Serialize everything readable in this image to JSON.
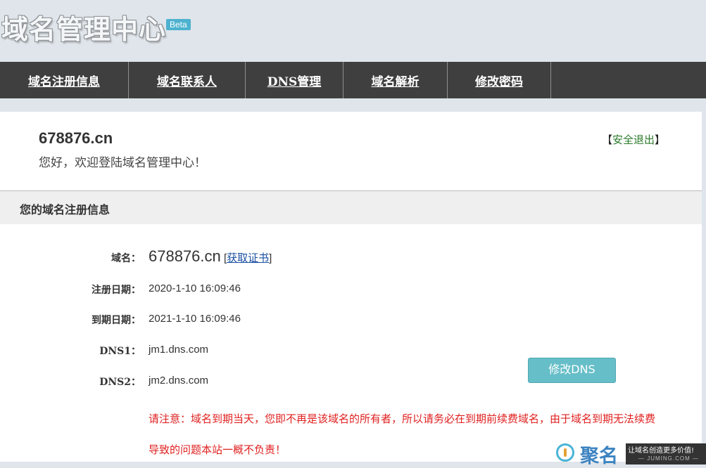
{
  "header": {
    "logo_text": "域名管理中心",
    "beta_label": "Beta"
  },
  "nav": {
    "items": [
      {
        "label": "域名注册信息"
      },
      {
        "label": "域名联系人"
      },
      {
        "label": "DNS管理"
      },
      {
        "label": "域名解析"
      },
      {
        "label": "修改密码"
      }
    ]
  },
  "account": {
    "domain": "678876.cn",
    "welcome": "您好，欢迎登陆域名管理中心！",
    "logout_open": "【",
    "logout_label": "安全退出",
    "logout_close": "】"
  },
  "section": {
    "title": "您的域名注册信息"
  },
  "details": {
    "domain_label": "域名：",
    "domain_value": "678876.cn",
    "cert_open": "[",
    "cert_link": "获取证书",
    "cert_close": "]",
    "reg_label": "注册日期：",
    "reg_value": "2020-1-10 16:09:46",
    "exp_label": "到期日期：",
    "exp_value": "2021-1-10 16:09:46",
    "dns1_label": "DNS1：",
    "dns1_value": "jm1.dns.com",
    "dns2_label": "DNS2：",
    "dns2_value": "jm2.dns.com",
    "modify_dns_button": "修改DNS",
    "notice": "请注意：域名到期当天，您即不再是该域名的所有者，所以请务必在到期前续费域名，由于域名到期无法续费导致的问题本站一概不负责！"
  },
  "watermark": {
    "brand": "聚名",
    "slogan": "让域名创造更多价值!",
    "url": "— JUMING.COM —"
  }
}
